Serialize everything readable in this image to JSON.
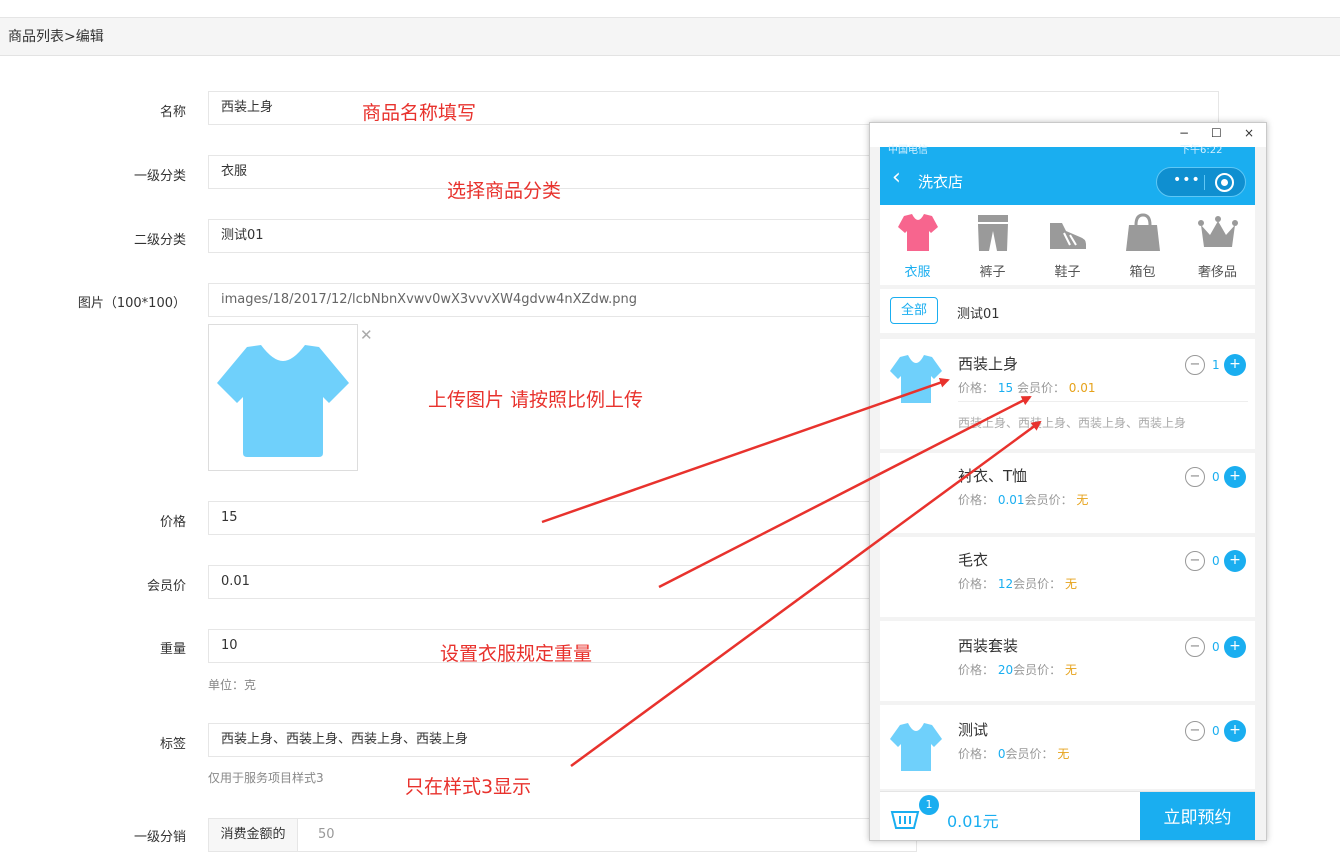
{
  "breadcrumb": "商品列表>编辑",
  "form": {
    "name_label": "名称",
    "name_value": "西装上身",
    "cat1_label": "一级分类",
    "cat1_value": "衣服",
    "cat2_label": "二级分类",
    "cat2_value": "测试01",
    "image_label": "图片（100*100）",
    "image_path": "images/18/2017/12/lcbNbnXvwv0wX3vvvXW4gdvw4nXZdw.png",
    "price_label": "价格",
    "price_value": "15",
    "member_label": "会员价",
    "member_value": "0.01",
    "weight_label": "重量",
    "weight_value": "10",
    "weight_hint": "单位：克",
    "tags_label": "标签",
    "tags_value": "西装上身、西装上身、西装上身、西装上身",
    "tags_hint": "仅用于服务项目样式3",
    "dist_label": "一级分销",
    "dist_prefix": "消费金额的",
    "dist_value": "50"
  },
  "annotations": {
    "name": "商品名称填写",
    "category": "选择商品分类",
    "image": "上传图片 请按照比例上传",
    "weight": "设置衣服规定重量",
    "tags": "只在样式3显示"
  },
  "phone": {
    "window_buttons": [
      "−",
      "☐",
      "×"
    ],
    "status_left": "中国电信",
    "status_right": "下午6:22",
    "title": "洗衣店",
    "back": "‹",
    "capsule_dots": "•••",
    "categories": [
      {
        "label": "衣服",
        "icon": "shirt-icon",
        "active": true
      },
      {
        "label": "裤子",
        "icon": "pants-icon",
        "active": false
      },
      {
        "label": "鞋子",
        "icon": "shoe-icon",
        "active": false
      },
      {
        "label": "箱包",
        "icon": "bag-icon",
        "active": false
      },
      {
        "label": "奢侈品",
        "icon": "crown-icon",
        "active": false
      }
    ],
    "subtab_all": "全部",
    "subtab_test": "测试01",
    "price_prefix": "价格：",
    "member_prefix": "会员价：",
    "items": [
      {
        "name": "西装上身",
        "price": "15",
        "member": "0.01",
        "qty": "1",
        "tags": "西装上身、西装上身、西装上身、西装上身",
        "has_img": true
      },
      {
        "name": "衬衣、T恤",
        "price": "0.01",
        "member": "无",
        "qty": "0",
        "has_img": false
      },
      {
        "name": "毛衣",
        "price": "12",
        "member": "无",
        "qty": "0",
        "has_img": false
      },
      {
        "name": "西装套装",
        "price": "20",
        "member": "无",
        "qty": "0",
        "has_img": false
      },
      {
        "name": "测试",
        "price": "0",
        "member": "无",
        "qty": "0",
        "has_img": true
      }
    ],
    "cart_count": "1",
    "total": "0.01元",
    "book_button": "立即预约"
  },
  "colors": {
    "accent": "#1aaef0",
    "annotation": "#e8322d",
    "member_price": "#e6a21a",
    "shirt_pink": "#f7658e",
    "shirt_blue": "#6fd0fb"
  }
}
